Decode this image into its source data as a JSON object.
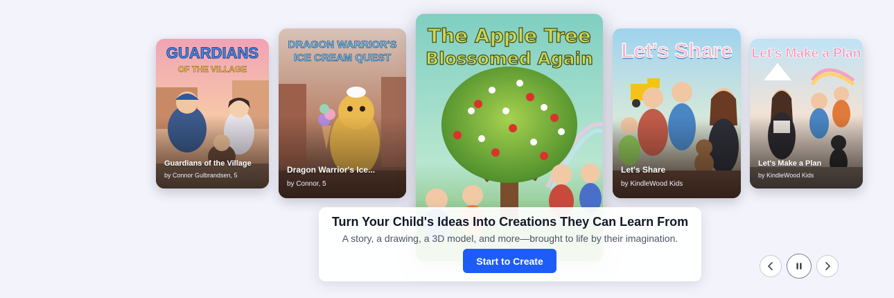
{
  "carousel": {
    "cards": [
      {
        "title": "Guardians of the Village",
        "author": "by Connor Gulbrandsen, 5",
        "cover_line1": "GUARDIANS",
        "cover_line2": "OF THE VILLAGE"
      },
      {
        "title": "Dragon Warrior's Ice...",
        "author": "by Connor, 5",
        "cover_line1": "DRAGON WARRIOR'S",
        "cover_line2": "ICE CREAM QUEST"
      },
      {
        "title": "The Apple Tree Blossomed Again",
        "author": "",
        "cover_line1": "The Apple Tree",
        "cover_line2": "Blossomed Again"
      },
      {
        "title": "Let's Share",
        "author": "by KindleWood Kids",
        "cover_line1": "Let's Share"
      },
      {
        "title": "Let's Make a Plan",
        "author": "by KindleWood Kids",
        "cover_line1": "Let's Make a Plan"
      }
    ]
  },
  "hero": {
    "heading": "Turn Your Child's Ideas Into Creations They Can Learn From",
    "subheading": "A story, a drawing, a 3D model, and more—brought to life by their imagination.",
    "cta_label": "Start to Create"
  },
  "controls": {
    "prev_icon": "chevron-left-icon",
    "pause_icon": "pause-icon",
    "next_icon": "chevron-right-icon"
  },
  "colors": {
    "background": "#f2f3fb",
    "accent": "#1d5cf6",
    "heading": "#111827",
    "body_text": "#4b5563"
  }
}
